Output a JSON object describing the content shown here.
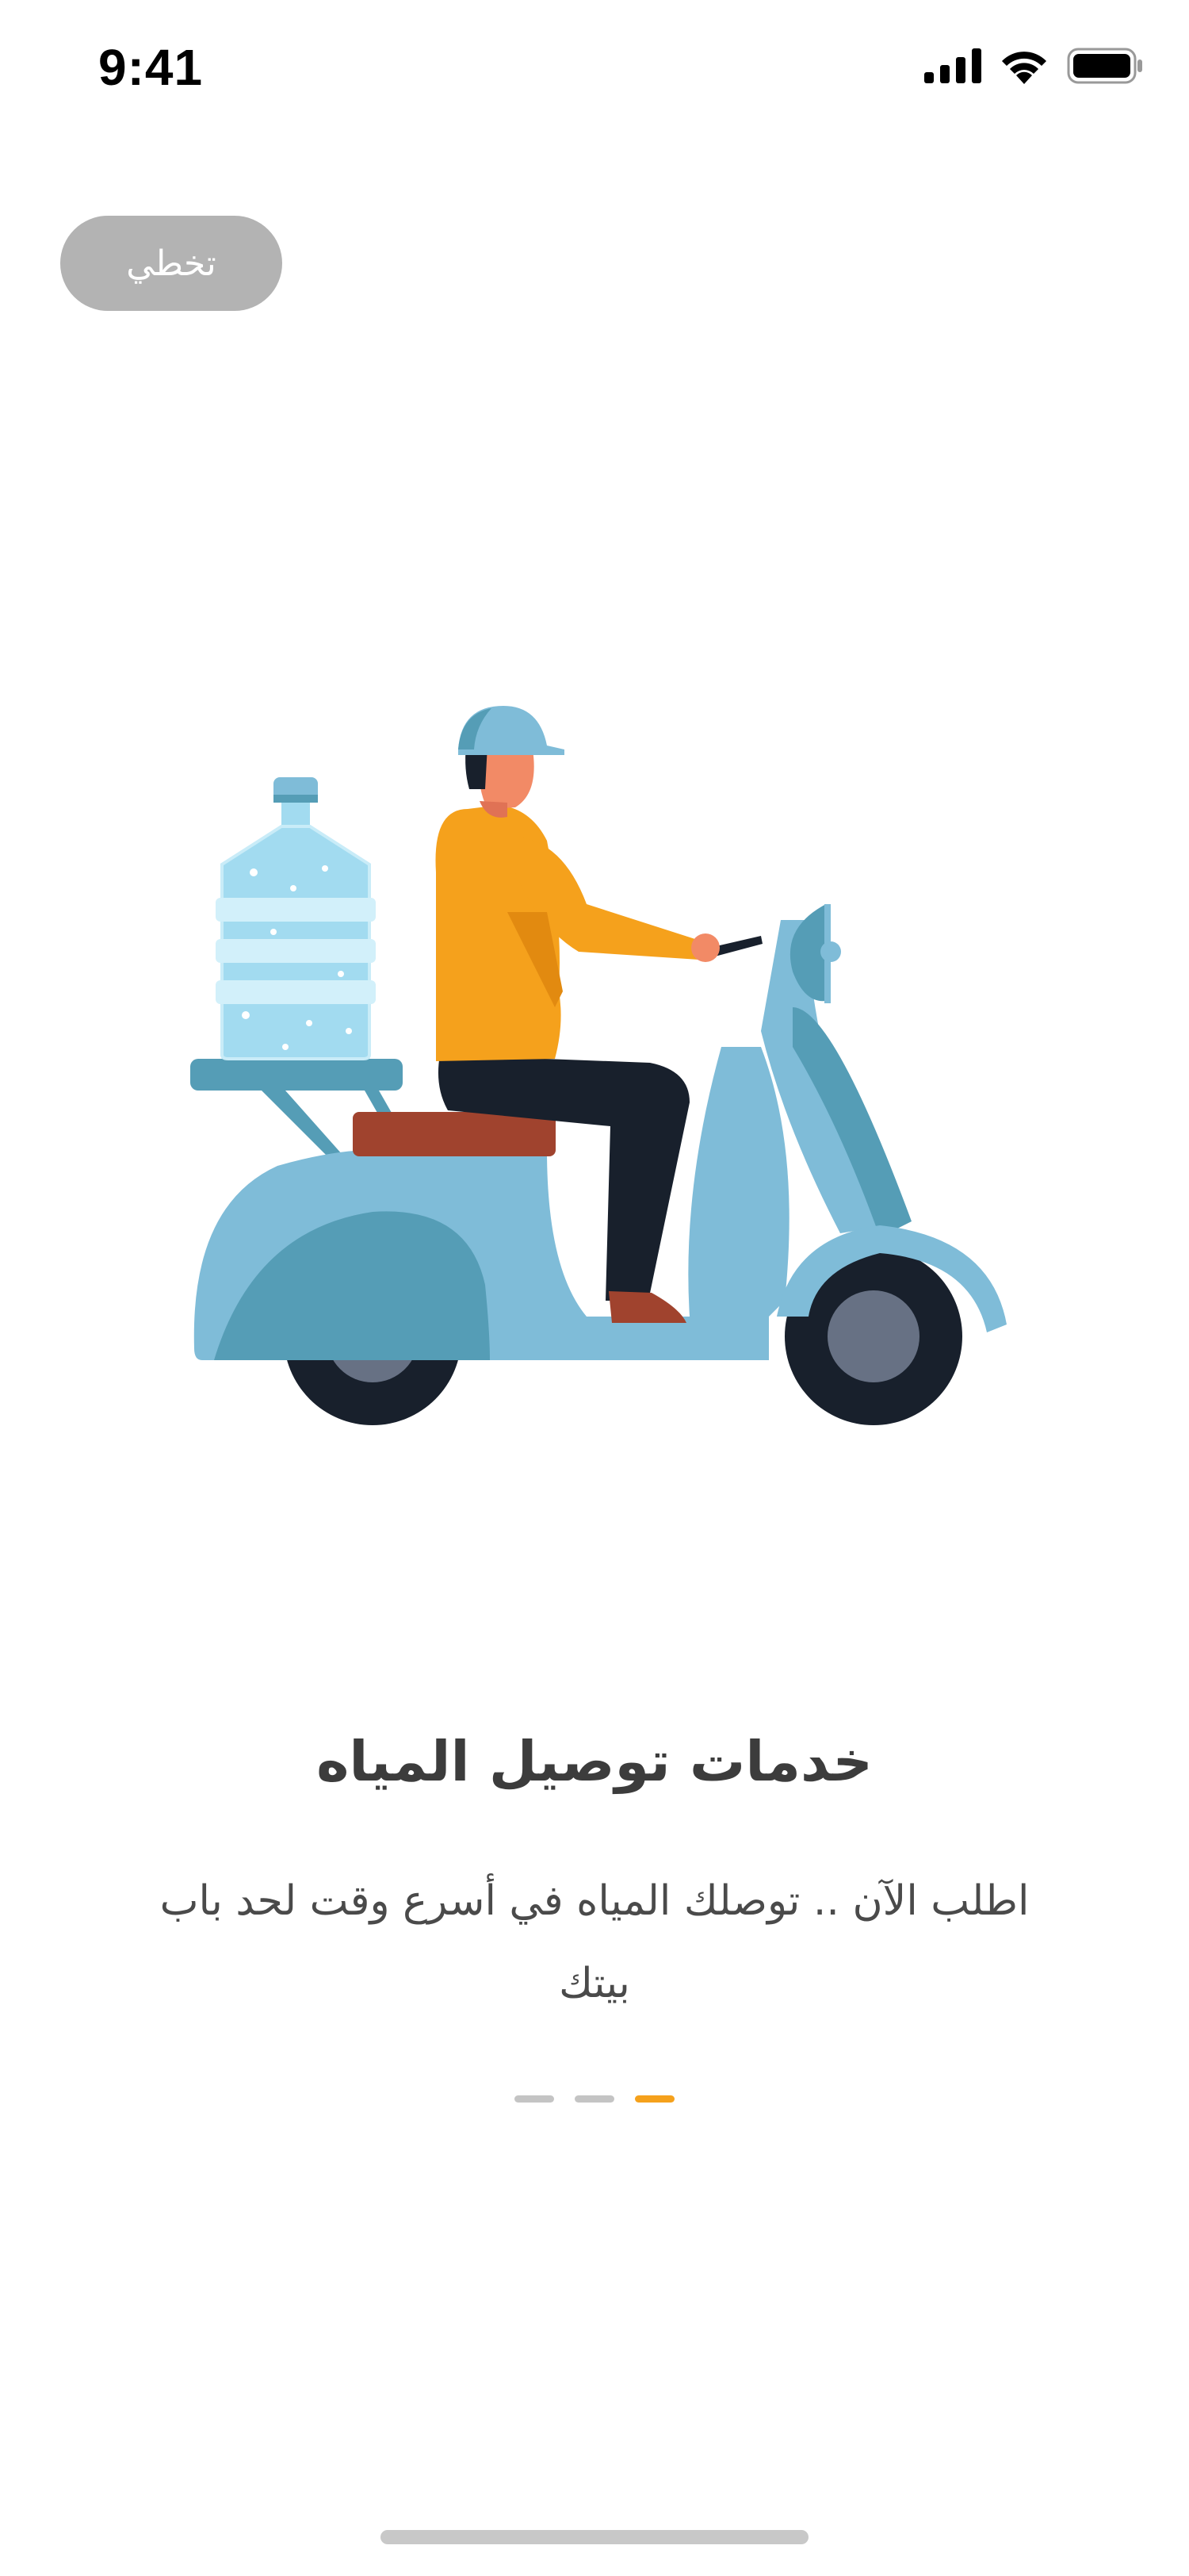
{
  "status_bar": {
    "time": "9:41",
    "icons": [
      "signal-icon",
      "wifi-icon",
      "battery-icon"
    ]
  },
  "skip_button": {
    "label": "تخطي"
  },
  "illustration": {
    "name": "delivery-scooter-illustration"
  },
  "onboarding": {
    "title": "خدمات توصيل المياه",
    "subtitle": "اطلب الآن .. توصلك المياه في أسرع وقت لحد باب بيتك"
  },
  "page_indicator": {
    "total": 3,
    "active_index": 3
  },
  "colors": {
    "accent": "#f5a11c",
    "skip_bg": "#b3b3b3",
    "scooter": "#7fbcd8",
    "scooter_dark": "#559db6",
    "title_text": "#3c3c3c"
  }
}
